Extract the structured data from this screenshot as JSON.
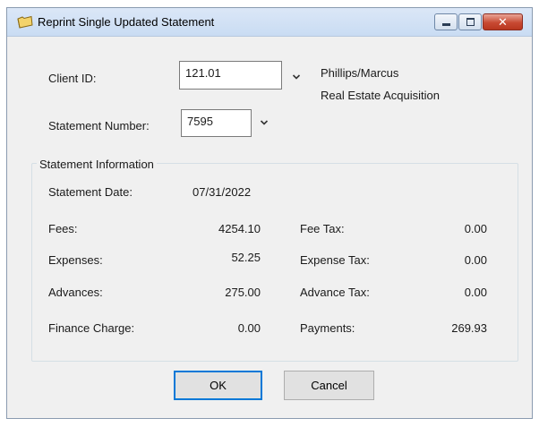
{
  "window": {
    "title": "Reprint Single Updated Statement",
    "close_label": "✕"
  },
  "client": {
    "label": "Client ID:",
    "value": "121.01",
    "name": "Phillips/Marcus",
    "matter": "Real Estate Acquisition"
  },
  "statement": {
    "label": "Statement Number:",
    "value": "7595"
  },
  "info": {
    "group_title": "Statement Information",
    "date_label": "Statement Date:",
    "date_value": "07/31/2022",
    "fees_label": "Fees:",
    "fees_value": "4254.10",
    "fee_tax_label": "Fee Tax:",
    "fee_tax_value": "0.00",
    "expenses_label": "Expenses:",
    "expenses_value": "52.25",
    "expense_tax_label": "Expense Tax:",
    "expense_tax_value": "0.00",
    "advances_label": "Advances:",
    "advances_value": "275.00",
    "advance_tax_label": "Advance Tax:",
    "advance_tax_value": "0.00",
    "finance_label": "Finance Charge:",
    "finance_value": "0.00",
    "payments_label": "Payments:",
    "payments_value": "269.93"
  },
  "buttons": {
    "ok": "OK",
    "cancel": "Cancel"
  },
  "icons": {
    "title": "folder-icon",
    "dropdown": "chevron-down-icon"
  }
}
